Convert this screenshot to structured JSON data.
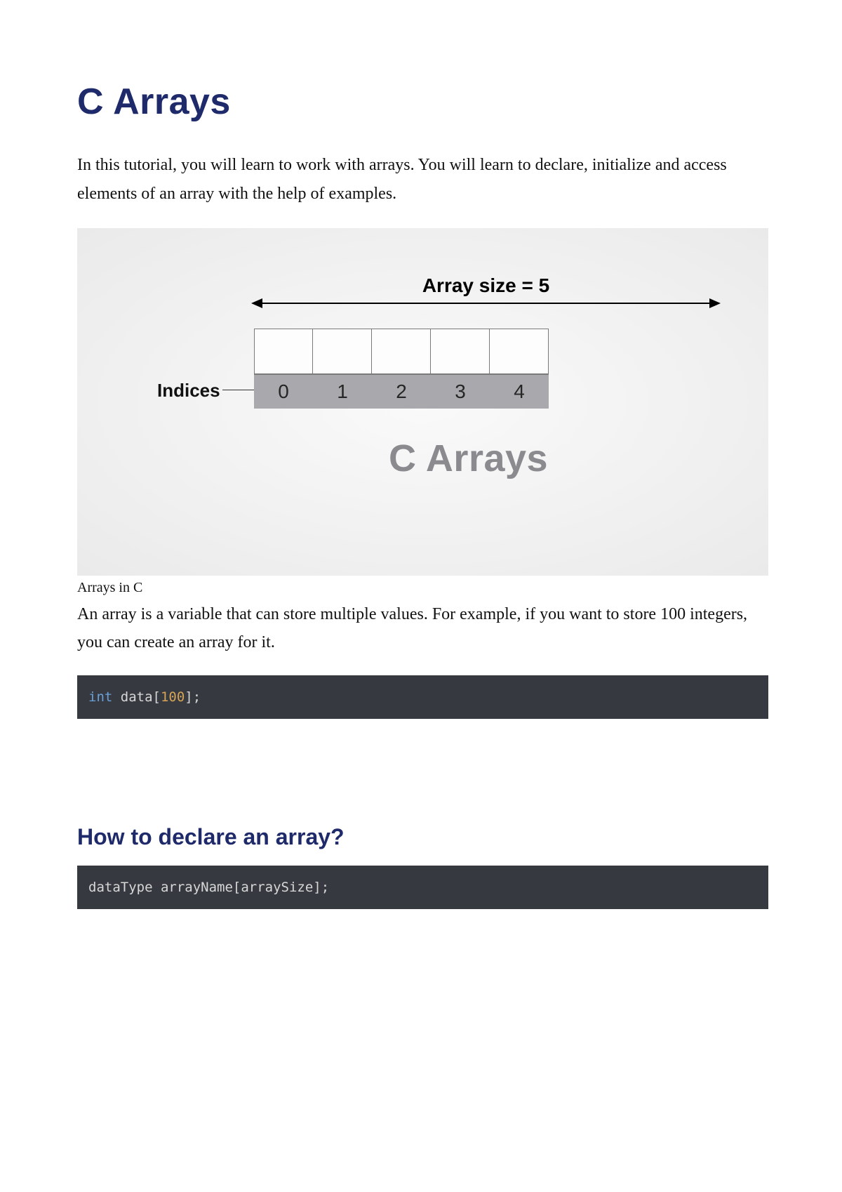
{
  "title": "C Arrays",
  "intro": "In this tutorial, you will learn to work with arrays. You will learn to declare, initialize and access elements of an array with the help of examples.",
  "diagram": {
    "arrow_label": "Array size = 5",
    "indices_label": "Indices",
    "indices": [
      "0",
      "1",
      "2",
      "3",
      "4"
    ],
    "title": "C Arrays"
  },
  "caption": "Arrays in C",
  "definition": "An array is a variable that can store multiple values. For example, if you want to store 100 integers, you can create an array for it.",
  "code1": {
    "type_kw": "int",
    "ident": " data[",
    "num": "100",
    "tail": "];"
  },
  "h2": "How to declare an array?",
  "code2": "dataType arrayName[arraySize];"
}
